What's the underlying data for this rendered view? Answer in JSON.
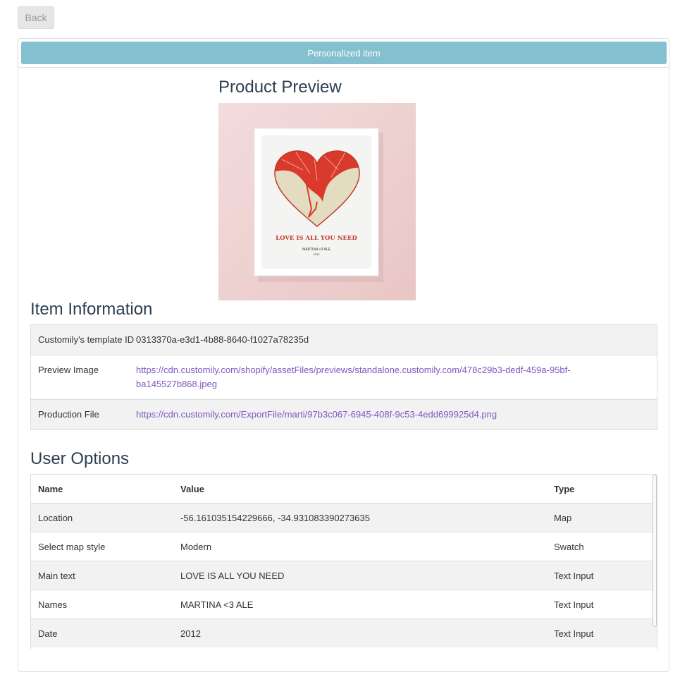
{
  "nav": {
    "back_label": "Back"
  },
  "panel": {
    "heading": "Personalized item"
  },
  "preview": {
    "title": "Product Preview",
    "image": {
      "main_text": "LOVE IS ALL YOU NEED",
      "names": "MARTINA <3 ALE",
      "date": "2012"
    }
  },
  "item_info": {
    "title": "Item Information",
    "rows": [
      {
        "key": "Customily's template ID",
        "value": "0313370a-e3d1-4b88-8640-f1027a78235d"
      },
      {
        "key": "Preview Image",
        "value": "https://cdn.customily.com/shopify/assetFiles/previews/standalone.customily.com/478c29b3-dedf-459a-95bf-ba145527b868.jpeg"
      },
      {
        "key": "Production File",
        "value": "https://cdn.customily.com/ExportFile/marti/97b3c067-6945-408f-9c53-4edd699925d4.png"
      }
    ]
  },
  "user_options": {
    "title": "User Options",
    "headers": {
      "name": "Name",
      "value": "Value",
      "type": "Type"
    },
    "rows": [
      {
        "name": "Location",
        "value": "-56.161035154229666, -34.931083390273635",
        "type": "Map"
      },
      {
        "name": "Select map style",
        "value": "Modern",
        "type": "Swatch"
      },
      {
        "name": "Main text",
        "value": "LOVE IS ALL YOU NEED",
        "type": "Text Input"
      },
      {
        "name": "Names",
        "value": "MARTINA <3 ALE",
        "type": "Text Input"
      },
      {
        "name": "Date",
        "value": "2012",
        "type": "Text Input"
      }
    ]
  },
  "colors": {
    "heading_bar": "#84c0d0",
    "link": "#7e57c2",
    "heart_red": "#d93a2b",
    "heart_land": "#e4dcc0",
    "poster_text": "#c0392b"
  }
}
